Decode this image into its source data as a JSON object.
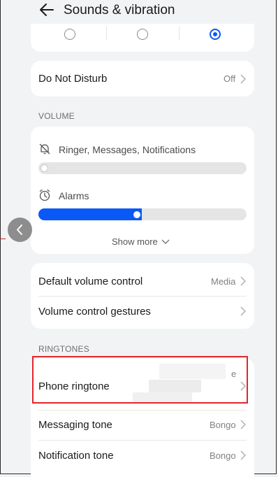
{
  "header": {
    "title": "Sounds & vibration",
    "back_icon": "back-arrow-icon"
  },
  "sound_mode": {
    "options": [
      {
        "selected": false
      },
      {
        "selected": false
      },
      {
        "selected": true
      }
    ]
  },
  "do_not_disturb": {
    "label": "Do Not Disturb",
    "value": "Off"
  },
  "volume": {
    "section_label": "VOLUME",
    "ringer": {
      "label": "Ringer, Messages, Notifications",
      "icon": "bell-muted-icon",
      "level": 0
    },
    "alarms": {
      "label": "Alarms",
      "icon": "alarm-clock-icon",
      "level": 0.5
    },
    "show_more": "Show more"
  },
  "controls": {
    "default_volume": {
      "label": "Default volume control",
      "value": "Media"
    },
    "gestures": {
      "label": "Volume control gestures"
    }
  },
  "ringtones": {
    "section_label": "RINGTONES",
    "phone": {
      "label": "Phone ringtone",
      "value_partial": "e"
    },
    "messaging": {
      "label": "Messaging tone",
      "value": "Bongo"
    },
    "notification": {
      "label": "Notification tone",
      "value": "Bongo"
    }
  },
  "colors": {
    "accent": "#0a59f7",
    "highlight": "#e0262d",
    "background": "#f1f3f5",
    "card": "#ffffff"
  }
}
